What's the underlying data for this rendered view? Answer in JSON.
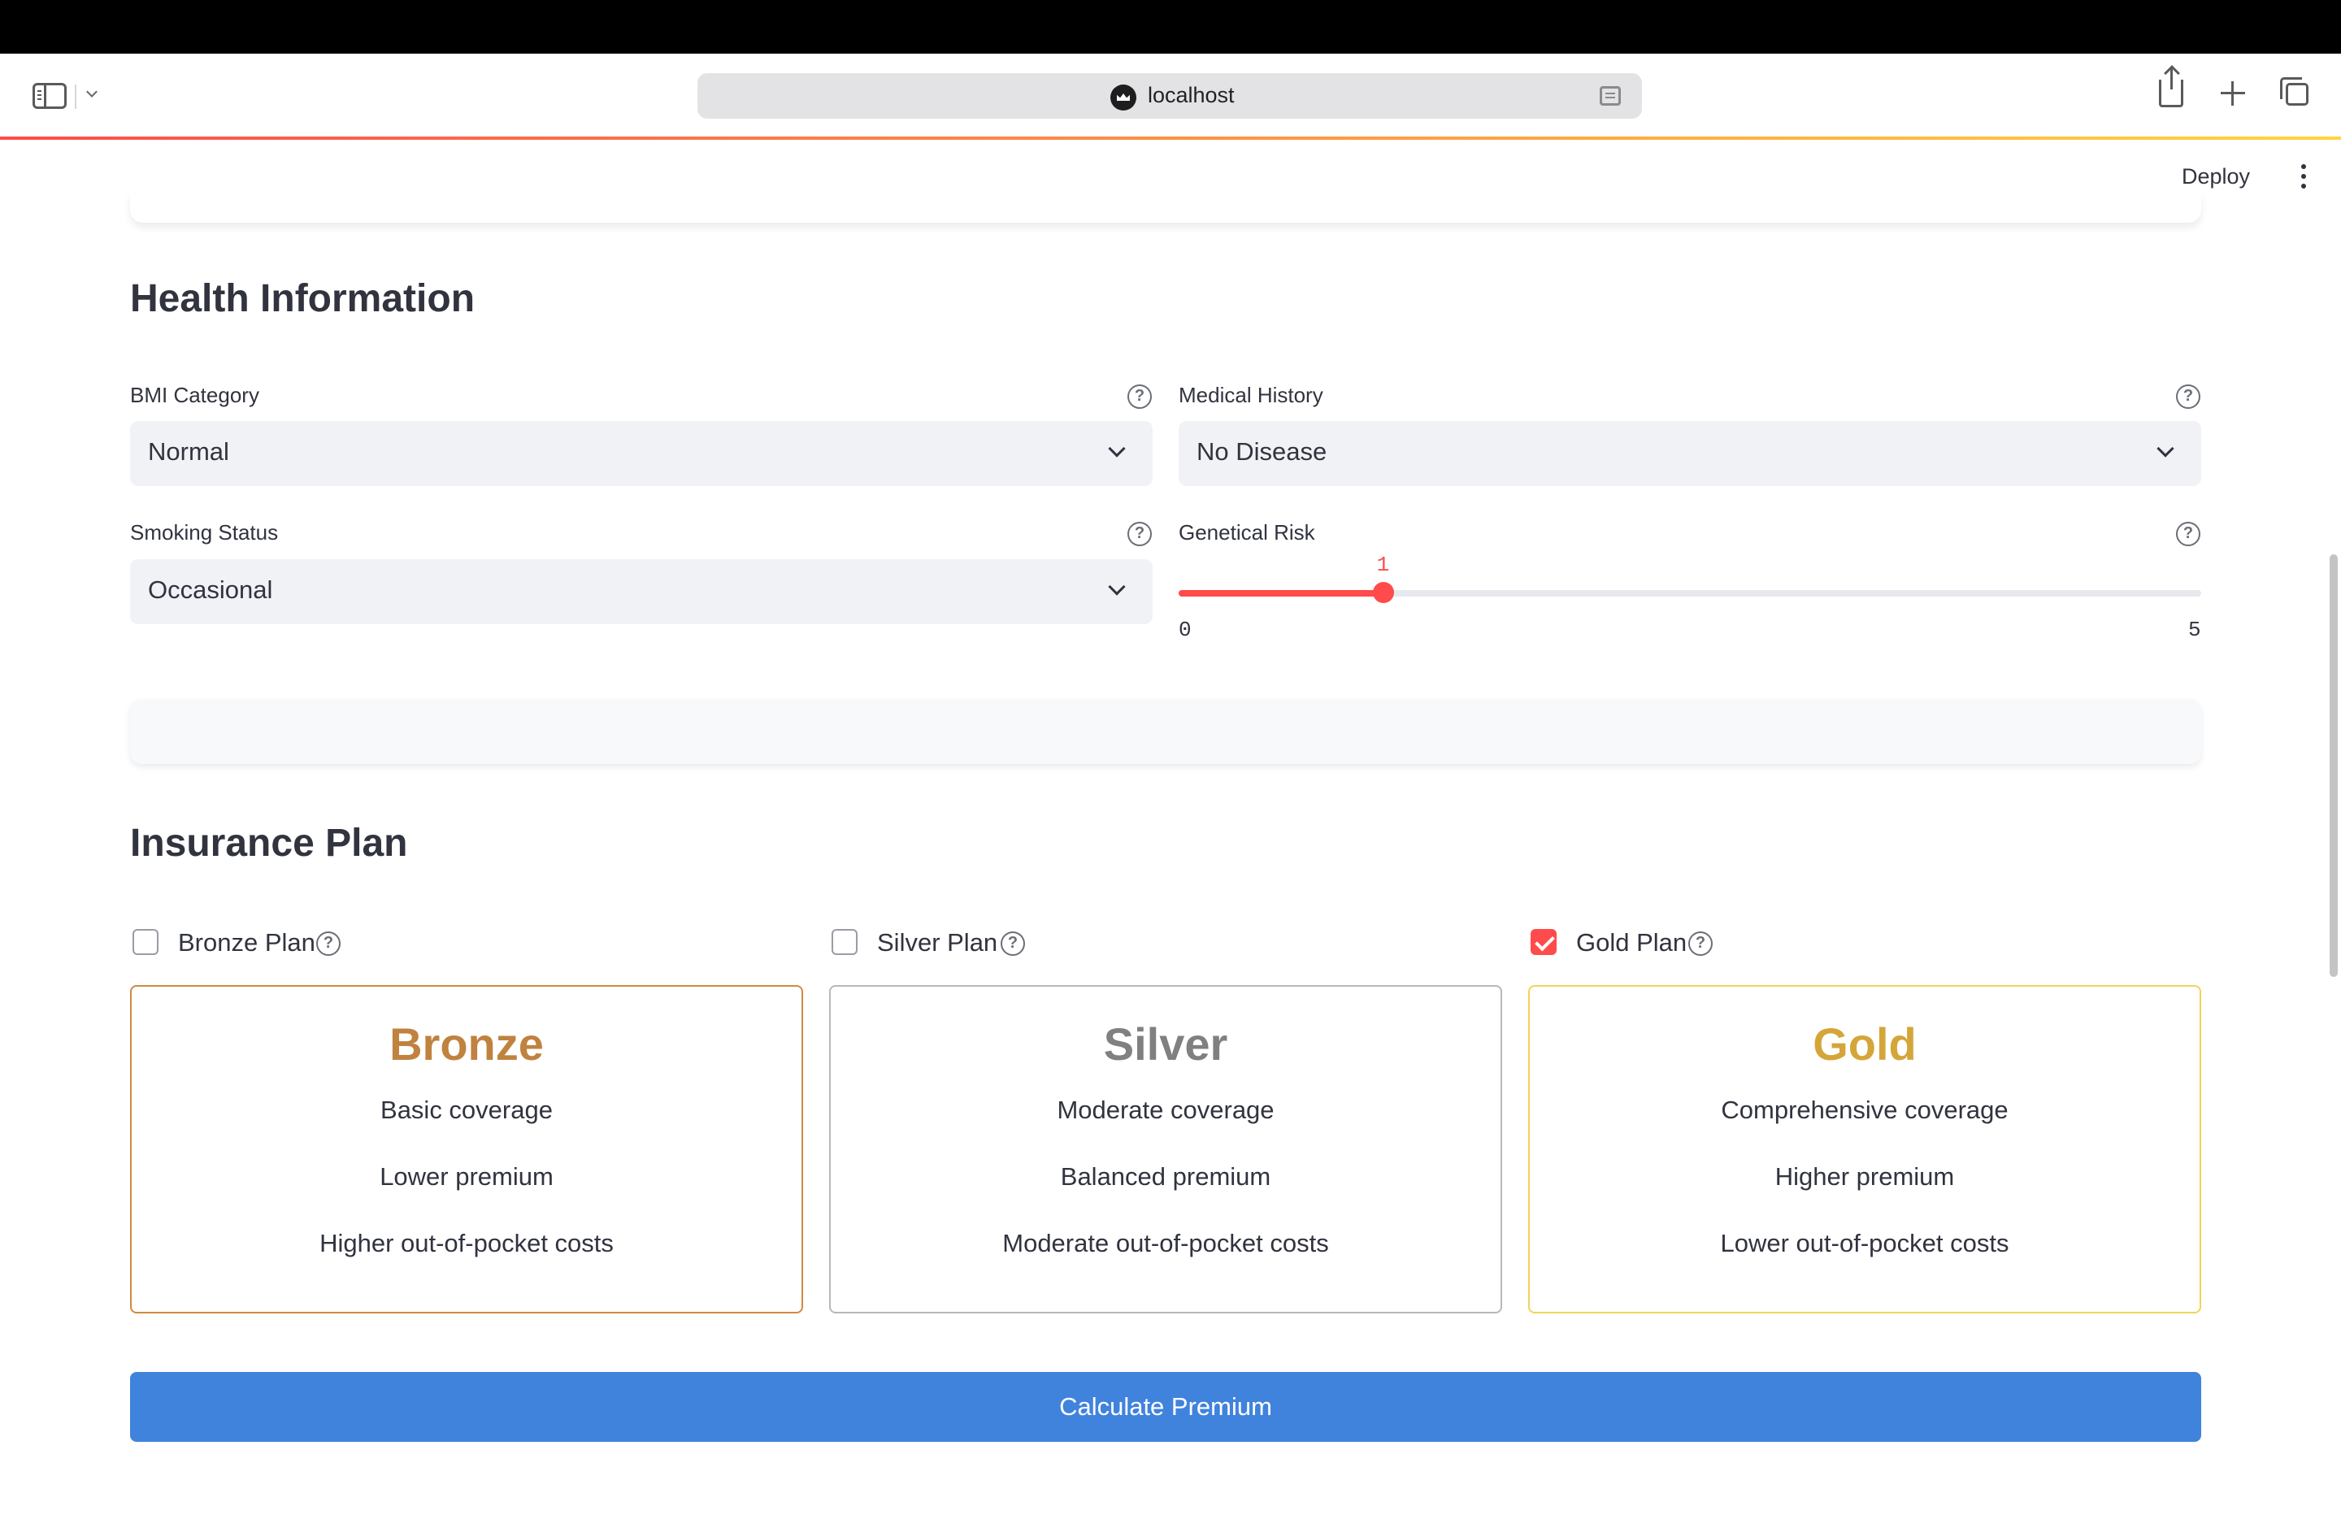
{
  "browser": {
    "url": "localhost"
  },
  "header": {
    "deploy_label": "Deploy"
  },
  "health": {
    "title": "Health Information",
    "bmi": {
      "label": "BMI Category",
      "value": "Normal"
    },
    "medical_history": {
      "label": "Medical History",
      "value": "No Disease"
    },
    "smoking": {
      "label": "Smoking Status",
      "value": "Occasional"
    },
    "genetical_risk": {
      "label": "Genetical Risk",
      "value": "1",
      "min": "0",
      "max": "5",
      "value_fraction": 0.2
    }
  },
  "insurance": {
    "title": "Insurance Plan",
    "checkboxes": [
      {
        "label": "Bronze Plan",
        "checked": false
      },
      {
        "label": "Silver Plan",
        "checked": false
      },
      {
        "label": "Gold Plan",
        "checked": true
      }
    ],
    "plans": [
      {
        "name": "Bronze",
        "color": "#c0823f",
        "border": "#d08a3f",
        "lines": [
          "Basic coverage",
          "Lower premium",
          "Higher out-of-pocket costs"
        ]
      },
      {
        "name": "Silver",
        "color": "#808080",
        "border": "#b8b8b8",
        "lines": [
          "Moderate coverage",
          "Balanced premium",
          "Moderate out-of-pocket costs"
        ]
      },
      {
        "name": "Gold",
        "color": "#d4a63a",
        "border": "#f2d35a",
        "lines": [
          "Comprehensive coverage",
          "Higher premium",
          "Lower out-of-pocket costs"
        ]
      }
    ]
  },
  "actions": {
    "calculate_label": "Calculate Premium"
  },
  "colors": {
    "accent": "#ff4b4b",
    "button": "#4083dd"
  }
}
